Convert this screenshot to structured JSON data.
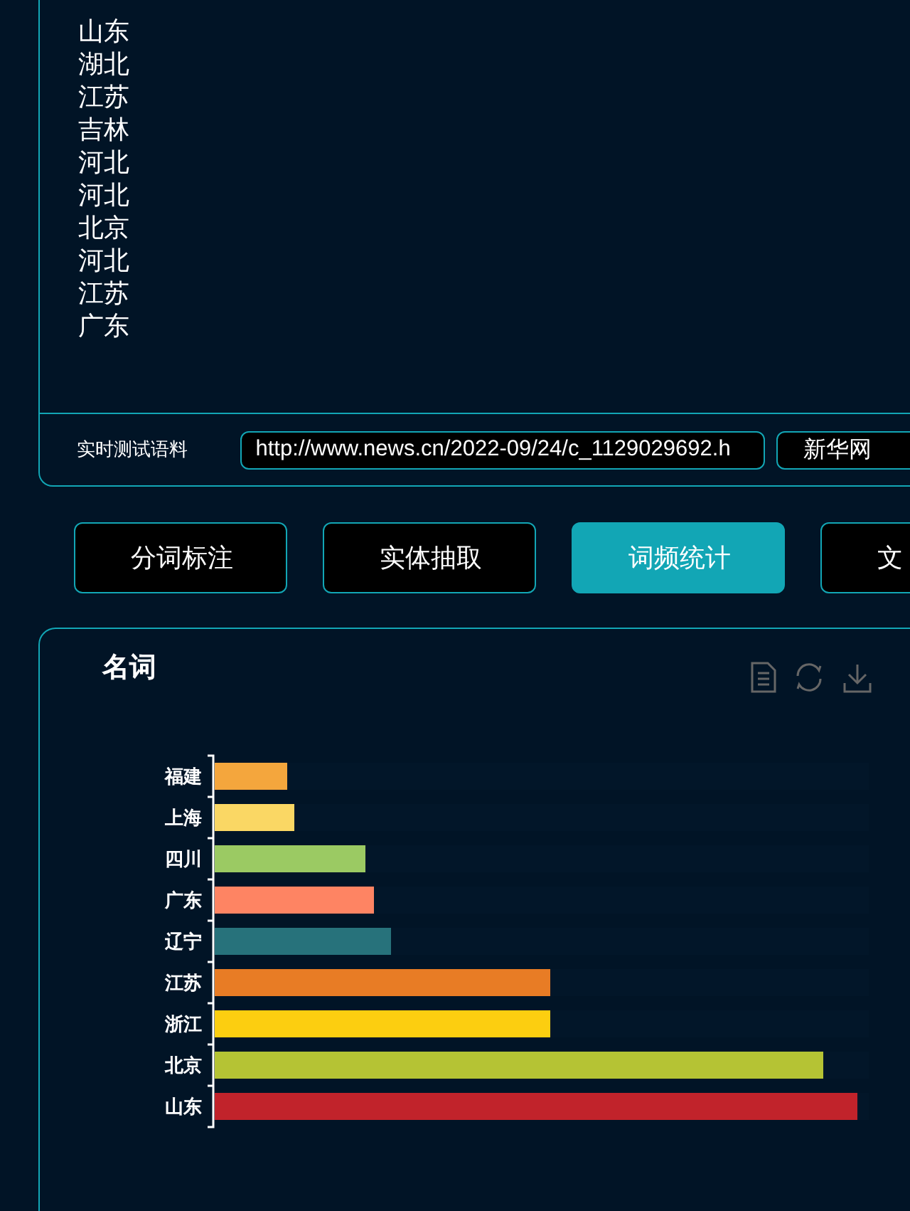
{
  "result_list": [
    "山东",
    "湖北",
    "江苏",
    "吉林",
    "河北",
    "河北",
    "北京",
    "河北",
    "江苏",
    "广东"
  ],
  "corpus": {
    "label": "实时测试语料",
    "url": "http://www.news.cn/2022-09/24/c_1129029692.h",
    "source": "新华网"
  },
  "tabs": [
    {
      "label": "分词标注",
      "selected": false
    },
    {
      "label": "实体抽取",
      "selected": false
    },
    {
      "label": "词频统计",
      "selected": true
    },
    {
      "label": "文",
      "selected": false
    }
  ],
  "panel": {
    "title": "名词",
    "bars": [
      {
        "label": "福建",
        "color": "#f4a63d",
        "level": 0.11
      },
      {
        "label": "上海",
        "color": "#fad764",
        "level": 0.122
      },
      {
        "label": "四川",
        "color": "#9bca63",
        "level": 0.23
      },
      {
        "label": "广东",
        "color": "#fe8463",
        "level": 0.244
      },
      {
        "label": "辽宁",
        "color": "#27727b",
        "level": 0.27
      },
      {
        "label": "江苏",
        "color": "#e87c25",
        "level": 0.513
      },
      {
        "label": "浙江",
        "color": "#fcce10",
        "level": 0.513
      },
      {
        "label": "北京",
        "color": "#b5c334",
        "level": 0.93
      },
      {
        "label": "山东",
        "color": "#c1232b",
        "level": 0.983
      }
    ]
  }
}
